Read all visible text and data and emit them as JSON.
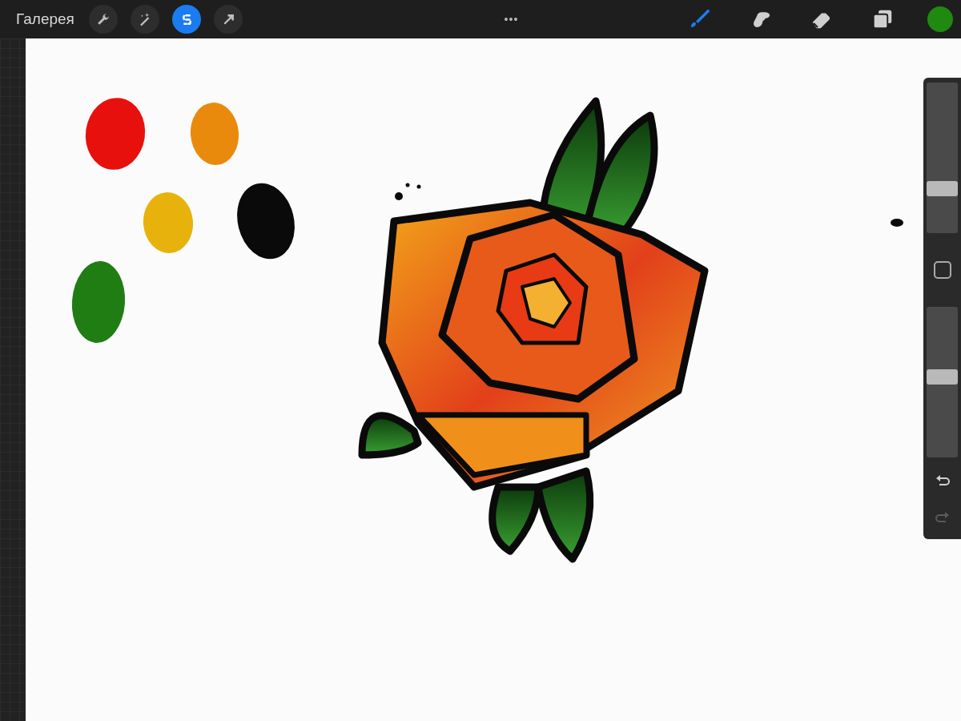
{
  "toolbar": {
    "gallery_label": "Галерея",
    "more_label": "•••",
    "left_tools": [
      {
        "kind": "wrench",
        "selected": false
      },
      {
        "kind": "wand",
        "selected": false
      },
      {
        "kind": "selection",
        "selected": true
      },
      {
        "kind": "transform",
        "selected": false
      }
    ],
    "right_tools": [
      {
        "kind": "brush",
        "selected": true
      },
      {
        "kind": "smudge",
        "selected": false
      },
      {
        "kind": "eraser",
        "selected": false
      },
      {
        "kind": "layers",
        "selected": false
      }
    ],
    "color_button": {
      "color": "#1f8a10"
    }
  },
  "canvas": {
    "paint_swatches": [
      {
        "color": "#e8100c"
      },
      {
        "color": "#ea8a0c"
      },
      {
        "color": "#e8b20c"
      },
      {
        "color": "#0a0a0a"
      },
      {
        "color": "#1f7d14"
      }
    ]
  },
  "sidebar": {
    "brush_size": {
      "level": 0.29
    },
    "opacity": {
      "level": 0.53
    },
    "redo": {
      "disabled": true
    }
  }
}
